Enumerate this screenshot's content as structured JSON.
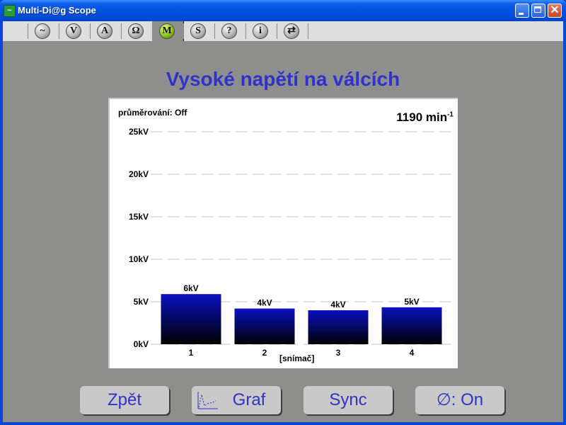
{
  "window": {
    "title": "Multi-Di@g Scope",
    "buttons": [
      "minimize",
      "maximize",
      "close"
    ]
  },
  "toolbar": {
    "items": [
      {
        "icon": "sine-wave-icon",
        "glyph": "~",
        "active": false
      },
      {
        "icon": "voltage-icon",
        "glyph": "V",
        "active": false
      },
      {
        "icon": "ampere-icon",
        "glyph": "A",
        "active": false
      },
      {
        "icon": "ohm-icon",
        "glyph": "Ω",
        "active": false
      },
      {
        "icon": "m-icon",
        "glyph": "M",
        "active": true
      },
      {
        "icon": "s-icon",
        "glyph": "S",
        "active": false
      },
      {
        "icon": "help-icon",
        "glyph": "?",
        "active": false
      },
      {
        "icon": "info-icon",
        "glyph": "i",
        "active": false
      },
      {
        "icon": "switch-window-icon",
        "glyph": "⇄",
        "active": false
      }
    ]
  },
  "page": {
    "title": "Vysoké napětí na válcích"
  },
  "chart_data": {
    "type": "bar",
    "title": "Vysoké napětí na válcích",
    "averaging_label": "průměrování: Off",
    "rpm_value": "1190 min",
    "rpm_unit_exp": "-1",
    "categories": [
      "1",
      "2",
      "3",
      "4"
    ],
    "values": [
      5.9,
      4.2,
      4.0,
      4.35
    ],
    "value_labels": [
      "6kV",
      "4kV",
      "4kV",
      "5kV"
    ],
    "unit": "kV",
    "yticks": [
      0,
      5,
      10,
      15,
      20,
      25
    ],
    "ytick_labels": [
      "0kV",
      "5kV",
      "10kV",
      "15kV",
      "20kV",
      "25kV"
    ],
    "ylim": [
      0,
      25
    ],
    "xlabel": "[snímač]",
    "ylabel": "",
    "grid": true,
    "bar_color_top": "#0a10c0",
    "bar_color_bottom": "#000000"
  },
  "buttons": {
    "back": "Zpět",
    "graph": "Graf",
    "sync": "Sync",
    "phase": "∅: On"
  }
}
